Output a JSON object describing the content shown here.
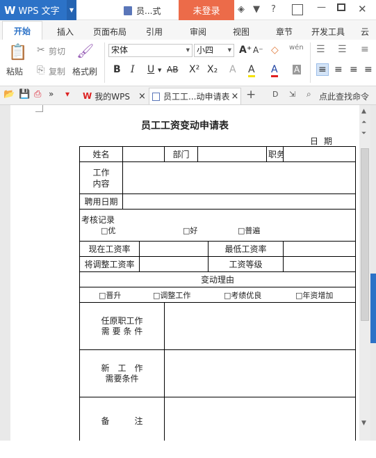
{
  "titlebar": {
    "logo": "W",
    "app_name": "WPS 文字",
    "doc_tab_short": "员...式",
    "login": "未登录"
  },
  "ribbon": {
    "tabs": [
      "开始",
      "插入",
      "页面布局",
      "引用",
      "审阅",
      "视图",
      "章节",
      "开发工具",
      "云"
    ]
  },
  "toolbar": {
    "paste": "粘贴",
    "cut": "剪切",
    "copy": "复制",
    "format_painter": "格式刷",
    "font_name": "宋体",
    "font_size": "小四",
    "bold": "B",
    "italic": "I",
    "underline": "U",
    "strike": "AB",
    "superscript": "X²",
    "subscript": "X₂",
    "font_color": "A",
    "shade": "A",
    "char_a": "A"
  },
  "quickbar": {
    "tab_mywps": "我的WPS",
    "tab_doc": "员工工...动申请表",
    "search": "点此查找命令"
  },
  "document": {
    "title": "员工工资变动申请表",
    "date_label": "日期",
    "row1": {
      "name": "姓名",
      "dept": "部门",
      "position": "职务"
    },
    "job_content": [
      "工作",
      "内容"
    ],
    "hire_date": "聘用日期",
    "assessment": {
      "label": "考核记录",
      "options": [
        "□优",
        "□好",
        "□普遍"
      ]
    },
    "current_salary": "现在工资率",
    "min_salary": "最低工资率",
    "adjusted_salary": "将调整工资率",
    "salary_grade": "工资等级",
    "change_reason": "变动理由",
    "reasons": [
      "□晋升",
      "□调整工作",
      "□考绩优良",
      "□年资增加"
    ],
    "orig_job_req": [
      "任原职工作",
      "需 要 条 件"
    ],
    "new_job_req": [
      "新　工　作",
      "需要条件"
    ],
    "remarks": "备　　　注"
  }
}
